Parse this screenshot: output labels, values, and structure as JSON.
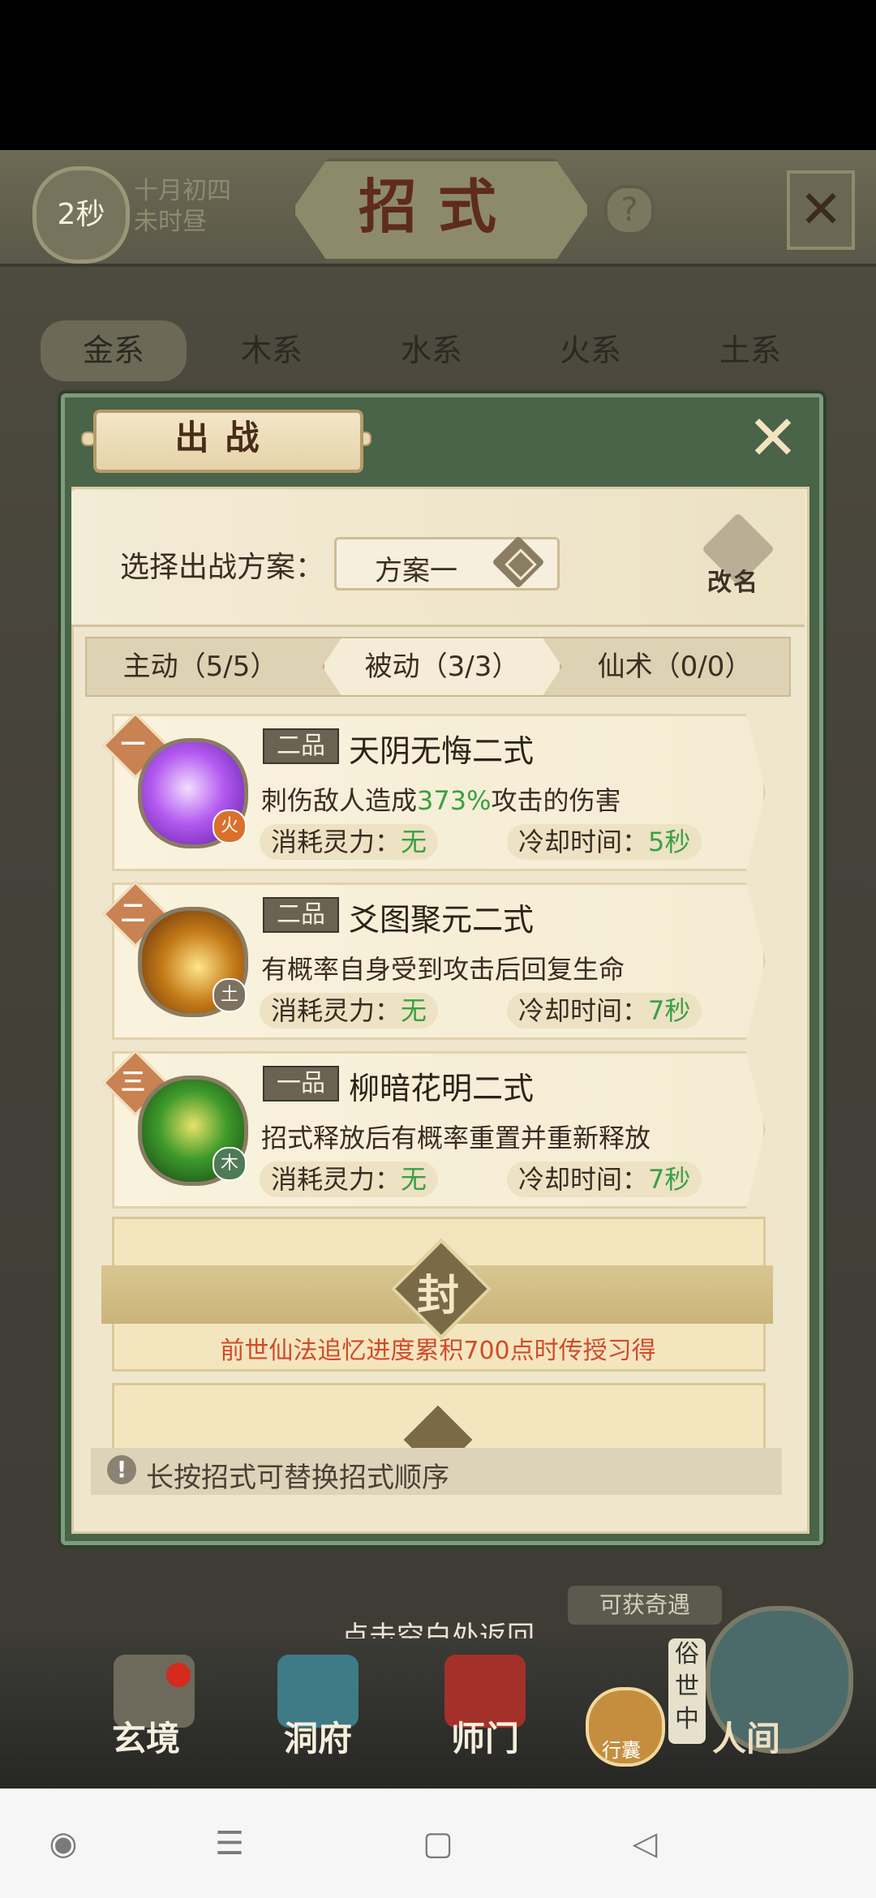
{
  "header": {
    "timer": "2秒",
    "date_line1": "十月初四",
    "date_line2": "未时昼",
    "title": "招式",
    "help_glyph": "?",
    "close_glyph": "✕"
  },
  "element_tabs": [
    "金系",
    "木系",
    "水系",
    "火系",
    "土系"
  ],
  "modal": {
    "title": "出战",
    "close_glyph": "✕",
    "scheme_label": "选择出战方案：",
    "scheme_value": "方案一",
    "rename_label": "改名",
    "mode_tabs": [
      "主动（5/5）",
      "被动（3/3）",
      "仙术（0/0）"
    ],
    "skills": [
      {
        "rank": "一",
        "element": "火",
        "grade": "二品",
        "name": "天阴无悔二式",
        "desc_pre": "刺伤敌人造成",
        "desc_highlight": "373%",
        "desc_post": "攻击的伤害",
        "cost_label": "消耗灵力：",
        "cost_value": "无",
        "cooldown_label": "冷却时间：",
        "cooldown_value": "5秒"
      },
      {
        "rank": "二",
        "element": "土",
        "grade": "二品",
        "name": "爻图聚元二式",
        "desc_pre": "有概率自身受到攻击后回复生命",
        "desc_highlight": "",
        "desc_post": "",
        "cost_label": "消耗灵力：",
        "cost_value": "无",
        "cooldown_label": "冷却时间：",
        "cooldown_value": "7秒"
      },
      {
        "rank": "三",
        "element": "木",
        "grade": "一品",
        "name": "柳暗花明二式",
        "desc_pre": "招式释放后有概率重置并重新释放",
        "desc_highlight": "",
        "desc_post": "",
        "cost_label": "消耗灵力：",
        "cost_value": "无",
        "cooldown_label": "冷却时间：",
        "cooldown_value": "7秒"
      }
    ],
    "locked_seal": "封",
    "locked_hint": "前世仙法追忆进度累积700点时传授习得",
    "tip_icon": "!",
    "tip_text": "长按招式可替换招式顺序"
  },
  "bottom": {
    "back_hint": "点击空白处返回",
    "adventure_tag": "可获奇遇",
    "nav": [
      "玄境",
      "洞府",
      "师门"
    ],
    "bag_label": "行囊",
    "vulgar_tag": "俗世中",
    "world_label": "人间"
  },
  "system_nav": {
    "circle": "◉",
    "menu": "☰",
    "square": "▢",
    "back": "◁"
  },
  "colors": {
    "modal_green": "#496448",
    "parchment": "#efe6ce",
    "highlight_green": "#3aa045",
    "hint_red": "#d24a2a",
    "rank_orange": "#c98251"
  }
}
